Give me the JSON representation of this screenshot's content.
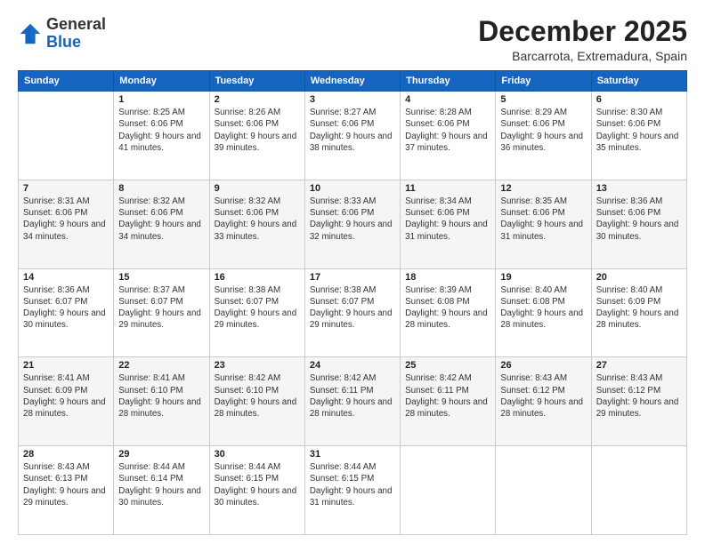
{
  "header": {
    "logo_general": "General",
    "logo_blue": "Blue",
    "month": "December 2025",
    "location": "Barcarrota, Extremadura, Spain"
  },
  "weekdays": [
    "Sunday",
    "Monday",
    "Tuesday",
    "Wednesday",
    "Thursday",
    "Friday",
    "Saturday"
  ],
  "weeks": [
    [
      {
        "day": "",
        "sunrise": "",
        "sunset": "",
        "daylight": ""
      },
      {
        "day": "1",
        "sunrise": "Sunrise: 8:25 AM",
        "sunset": "Sunset: 6:06 PM",
        "daylight": "Daylight: 9 hours and 41 minutes."
      },
      {
        "day": "2",
        "sunrise": "Sunrise: 8:26 AM",
        "sunset": "Sunset: 6:06 PM",
        "daylight": "Daylight: 9 hours and 39 minutes."
      },
      {
        "day": "3",
        "sunrise": "Sunrise: 8:27 AM",
        "sunset": "Sunset: 6:06 PM",
        "daylight": "Daylight: 9 hours and 38 minutes."
      },
      {
        "day": "4",
        "sunrise": "Sunrise: 8:28 AM",
        "sunset": "Sunset: 6:06 PM",
        "daylight": "Daylight: 9 hours and 37 minutes."
      },
      {
        "day": "5",
        "sunrise": "Sunrise: 8:29 AM",
        "sunset": "Sunset: 6:06 PM",
        "daylight": "Daylight: 9 hours and 36 minutes."
      },
      {
        "day": "6",
        "sunrise": "Sunrise: 8:30 AM",
        "sunset": "Sunset: 6:06 PM",
        "daylight": "Daylight: 9 hours and 35 minutes."
      }
    ],
    [
      {
        "day": "7",
        "sunrise": "Sunrise: 8:31 AM",
        "sunset": "Sunset: 6:06 PM",
        "daylight": "Daylight: 9 hours and 34 minutes."
      },
      {
        "day": "8",
        "sunrise": "Sunrise: 8:32 AM",
        "sunset": "Sunset: 6:06 PM",
        "daylight": "Daylight: 9 hours and 34 minutes."
      },
      {
        "day": "9",
        "sunrise": "Sunrise: 8:32 AM",
        "sunset": "Sunset: 6:06 PM",
        "daylight": "Daylight: 9 hours and 33 minutes."
      },
      {
        "day": "10",
        "sunrise": "Sunrise: 8:33 AM",
        "sunset": "Sunset: 6:06 PM",
        "daylight": "Daylight: 9 hours and 32 minutes."
      },
      {
        "day": "11",
        "sunrise": "Sunrise: 8:34 AM",
        "sunset": "Sunset: 6:06 PM",
        "daylight": "Daylight: 9 hours and 31 minutes."
      },
      {
        "day": "12",
        "sunrise": "Sunrise: 8:35 AM",
        "sunset": "Sunset: 6:06 PM",
        "daylight": "Daylight: 9 hours and 31 minutes."
      },
      {
        "day": "13",
        "sunrise": "Sunrise: 8:36 AM",
        "sunset": "Sunset: 6:06 PM",
        "daylight": "Daylight: 9 hours and 30 minutes."
      }
    ],
    [
      {
        "day": "14",
        "sunrise": "Sunrise: 8:36 AM",
        "sunset": "Sunset: 6:07 PM",
        "daylight": "Daylight: 9 hours and 30 minutes."
      },
      {
        "day": "15",
        "sunrise": "Sunrise: 8:37 AM",
        "sunset": "Sunset: 6:07 PM",
        "daylight": "Daylight: 9 hours and 29 minutes."
      },
      {
        "day": "16",
        "sunrise": "Sunrise: 8:38 AM",
        "sunset": "Sunset: 6:07 PM",
        "daylight": "Daylight: 9 hours and 29 minutes."
      },
      {
        "day": "17",
        "sunrise": "Sunrise: 8:38 AM",
        "sunset": "Sunset: 6:07 PM",
        "daylight": "Daylight: 9 hours and 29 minutes."
      },
      {
        "day": "18",
        "sunrise": "Sunrise: 8:39 AM",
        "sunset": "Sunset: 6:08 PM",
        "daylight": "Daylight: 9 hours and 28 minutes."
      },
      {
        "day": "19",
        "sunrise": "Sunrise: 8:40 AM",
        "sunset": "Sunset: 6:08 PM",
        "daylight": "Daylight: 9 hours and 28 minutes."
      },
      {
        "day": "20",
        "sunrise": "Sunrise: 8:40 AM",
        "sunset": "Sunset: 6:09 PM",
        "daylight": "Daylight: 9 hours and 28 minutes."
      }
    ],
    [
      {
        "day": "21",
        "sunrise": "Sunrise: 8:41 AM",
        "sunset": "Sunset: 6:09 PM",
        "daylight": "Daylight: 9 hours and 28 minutes."
      },
      {
        "day": "22",
        "sunrise": "Sunrise: 8:41 AM",
        "sunset": "Sunset: 6:10 PM",
        "daylight": "Daylight: 9 hours and 28 minutes."
      },
      {
        "day": "23",
        "sunrise": "Sunrise: 8:42 AM",
        "sunset": "Sunset: 6:10 PM",
        "daylight": "Daylight: 9 hours and 28 minutes."
      },
      {
        "day": "24",
        "sunrise": "Sunrise: 8:42 AM",
        "sunset": "Sunset: 6:11 PM",
        "daylight": "Daylight: 9 hours and 28 minutes."
      },
      {
        "day": "25",
        "sunrise": "Sunrise: 8:42 AM",
        "sunset": "Sunset: 6:11 PM",
        "daylight": "Daylight: 9 hours and 28 minutes."
      },
      {
        "day": "26",
        "sunrise": "Sunrise: 8:43 AM",
        "sunset": "Sunset: 6:12 PM",
        "daylight": "Daylight: 9 hours and 28 minutes."
      },
      {
        "day": "27",
        "sunrise": "Sunrise: 8:43 AM",
        "sunset": "Sunset: 6:12 PM",
        "daylight": "Daylight: 9 hours and 29 minutes."
      }
    ],
    [
      {
        "day": "28",
        "sunrise": "Sunrise: 8:43 AM",
        "sunset": "Sunset: 6:13 PM",
        "daylight": "Daylight: 9 hours and 29 minutes."
      },
      {
        "day": "29",
        "sunrise": "Sunrise: 8:44 AM",
        "sunset": "Sunset: 6:14 PM",
        "daylight": "Daylight: 9 hours and 30 minutes."
      },
      {
        "day": "30",
        "sunrise": "Sunrise: 8:44 AM",
        "sunset": "Sunset: 6:15 PM",
        "daylight": "Daylight: 9 hours and 30 minutes."
      },
      {
        "day": "31",
        "sunrise": "Sunrise: 8:44 AM",
        "sunset": "Sunset: 6:15 PM",
        "daylight": "Daylight: 9 hours and 31 minutes."
      },
      {
        "day": "",
        "sunrise": "",
        "sunset": "",
        "daylight": ""
      },
      {
        "day": "",
        "sunrise": "",
        "sunset": "",
        "daylight": ""
      },
      {
        "day": "",
        "sunrise": "",
        "sunset": "",
        "daylight": ""
      }
    ]
  ]
}
